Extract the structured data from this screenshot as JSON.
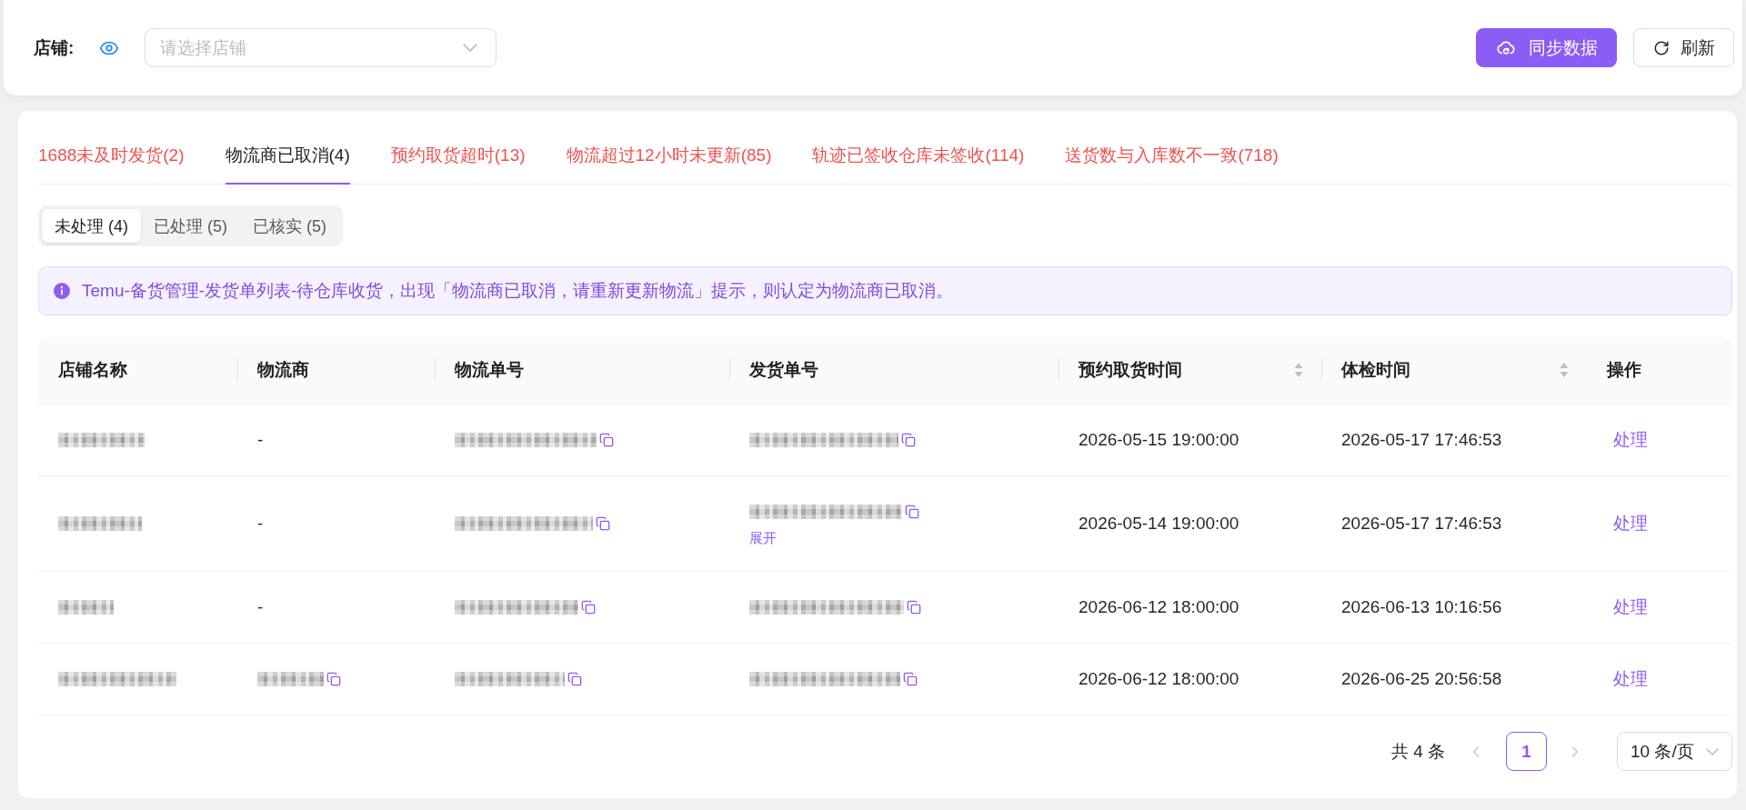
{
  "filter_bar": {
    "label": "店铺:",
    "store_select": {
      "placeholder": "请选择店铺"
    },
    "buttons": [
      {
        "kind": "primary",
        "label": "同步数据"
      },
      {
        "kind": "default",
        "label": "刷新"
      }
    ]
  },
  "tabs": [
    {
      "label": "1688未及时发货(2)",
      "selected": false
    },
    {
      "label": "物流商已取消(4)",
      "selected": true
    },
    {
      "label": "预约取货超时(13)",
      "selected": false
    },
    {
      "label": "物流超过12小时未更新(85)",
      "selected": false
    },
    {
      "label": "轨迹已签收仓库未签收(114)",
      "selected": false
    },
    {
      "label": "送货数与入库数不一致(718)",
      "selected": false
    }
  ],
  "status_tabs": [
    {
      "label": "未处理 (4)",
      "selected": true
    },
    {
      "label": "已处理 (5)",
      "selected": false
    },
    {
      "label": "已核实 (5)",
      "selected": false
    }
  ],
  "notice": {
    "text": "Temu-备货管理-发货单列表-待仓库收货，出现「物流商已取消，请重新更新物流」提示，则认定为物流商已取消。"
  },
  "table": {
    "columns": [
      {
        "label": "店铺名称",
        "sortable": false
      },
      {
        "label": "物流商",
        "sortable": false
      },
      {
        "label": "物流单号",
        "sortable": false
      },
      {
        "label": "发货单号",
        "sortable": false
      },
      {
        "label": "预约取货时间",
        "sortable": true
      },
      {
        "label": "体检时间",
        "sortable": true
      },
      {
        "label": "操作",
        "sortable": false
      }
    ],
    "rows": [
      {
        "store_name": {
          "kind": "pixelated",
          "copyable": false
        },
        "carrier": {
          "kind": "text",
          "text": "-",
          "copyable": false
        },
        "tracking_number": {
          "kind": "pixelated",
          "copyable": true
        },
        "shipment_number": {
          "kind": "pixelated",
          "copyable": true
        },
        "pickup_time": "2026-05-15 19:00:00",
        "inspection_time": "2026-05-17 17:46:53",
        "action": "处理"
      },
      {
        "store_name": {
          "kind": "pixelated",
          "copyable": false
        },
        "carrier": {
          "kind": "text",
          "text": "-",
          "copyable": false
        },
        "tracking_number": {
          "kind": "pixelated",
          "copyable": true
        },
        "shipment_number": {
          "kind": "pixelated",
          "copyable": true,
          "expand_link": "展开"
        },
        "pickup_time": "2026-05-14 19:00:00",
        "inspection_time": "2026-05-17 17:46:53",
        "action": "处理"
      },
      {
        "store_name": {
          "kind": "pixelated",
          "copyable": false
        },
        "carrier": {
          "kind": "text",
          "text": "-",
          "copyable": false
        },
        "tracking_number": {
          "kind": "pixelated",
          "copyable": true
        },
        "shipment_number": {
          "kind": "pixelated",
          "copyable": true
        },
        "pickup_time": "2026-06-12 18:00:00",
        "inspection_time": "2026-06-13 10:16:56",
        "action": "处理"
      },
      {
        "store_name": {
          "kind": "pixelated",
          "copyable": false
        },
        "carrier": {
          "kind": "pixelated",
          "copyable": true
        },
        "tracking_number": {
          "kind": "pixelated",
          "copyable": true
        },
        "shipment_number": {
          "kind": "pixelated",
          "copyable": true
        },
        "pickup_time": "2026-06-12 18:00:00",
        "inspection_time": "2026-06-25 20:56:58",
        "action": "处理"
      }
    ]
  },
  "pagination": {
    "total": "共 4 条",
    "previous": {
      "disabled": true
    },
    "pages": [
      {
        "label": "1",
        "selected": true
      }
    ],
    "next": {
      "disabled": true
    },
    "page_size": "10 条/页"
  }
}
